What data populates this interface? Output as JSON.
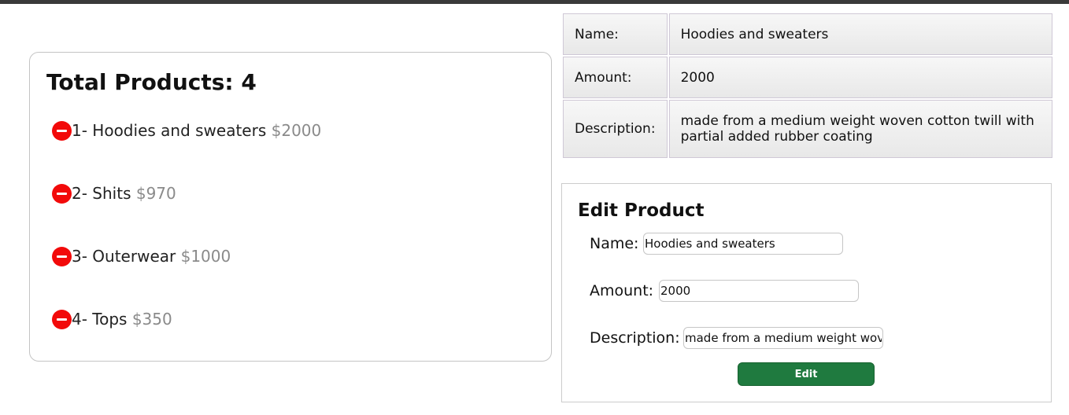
{
  "product_list": {
    "title": "Total Products: 4",
    "items": [
      {
        "label": "1- Hoodies and sweaters",
        "price": "$2000"
      },
      {
        "label": "2- Shits",
        "price": "$970"
      },
      {
        "label": "3- Outerwear",
        "price": "$1000"
      },
      {
        "label": "4- Tops",
        "price": "$350"
      }
    ]
  },
  "details": {
    "rows": [
      {
        "key": "Name:",
        "value": "Hoodies and sweaters"
      },
      {
        "key": "Amount:",
        "value": "2000"
      },
      {
        "key": "Description:",
        "value": "made from a medium weight woven cotton twill with partial added rubber coating"
      }
    ]
  },
  "edit_form": {
    "title": "Edit Product",
    "name_label": "Name:",
    "name_value": "Hoodies and sweaters",
    "amount_label": "Amount:",
    "amount_value": "2000",
    "description_label": "Description:",
    "description_value": "made from a medium weight woven cotton twill with partial added rubber coating",
    "submit_label": "Edit"
  },
  "colors": {
    "remove_icon": "#f20a0a",
    "edit_button": "#1f7a3f",
    "price_text": "#8a8a8a"
  }
}
